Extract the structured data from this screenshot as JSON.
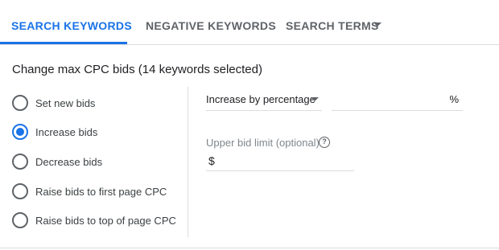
{
  "tabs": {
    "search_keywords": "SEARCH KEYWORDS",
    "negative_keywords": "NEGATIVE KEYWORDS",
    "search_terms": "SEARCH TERMS"
  },
  "accent_color": "#1a73e8",
  "heading": "Change max CPC bids (14 keywords selected)",
  "options": [
    {
      "label": "Set new bids",
      "selected": false
    },
    {
      "label": "Increase bids",
      "selected": true
    },
    {
      "label": "Decrease bids",
      "selected": false
    },
    {
      "label": "Raise bids to first page CPC",
      "selected": false
    },
    {
      "label": "Raise bids to top of page CPC",
      "selected": false
    }
  ],
  "adjustment": {
    "method": "Increase by percentage",
    "value": "",
    "suffix": "%"
  },
  "upper_limit": {
    "label": "Upper bid limit (optional)",
    "help_icon": "help-circle-icon",
    "help_glyph": "?",
    "prefix": "$",
    "value": ""
  }
}
